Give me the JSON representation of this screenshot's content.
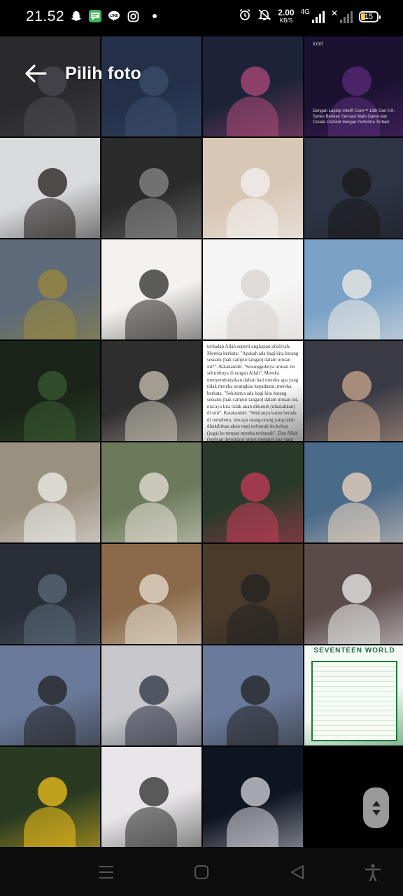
{
  "status_bar": {
    "time": "21.52",
    "net_speed_value": "2.00",
    "net_speed_unit": "KB/S",
    "network_type": "4G",
    "battery_level": "15",
    "notification_icons": [
      "snapchat-icon",
      "messages-icon",
      "line-icon",
      "instagram-icon"
    ],
    "status_icons": [
      "alarm-icon",
      "mute-icon"
    ]
  },
  "header": {
    "title": "Pilih foto",
    "back_icon": "arrow-left-icon"
  },
  "photos": [
    {
      "bg": "#2a2a2e",
      "accent": "#4a4a50"
    },
    {
      "bg": "#24304a",
      "accent": "#3a4d6b"
    },
    {
      "bg": "#1c2338",
      "accent": "#b04a7a"
    },
    {
      "bg": "#1a1230",
      "accent": "#5a2b7a",
      "ad_logo": "intel",
      "ad_text": "Dengan Laptop Intel® Core™ 13th Gen HX-Series Berikan Sensasi Main Game dan Create Content dengan Performa Terbaik"
    },
    {
      "bg": "#d9dadc",
      "accent": "#1e1a18"
    },
    {
      "bg": "#2b2b2b",
      "accent": "#8a8a8a"
    },
    {
      "bg": "#d9c7b5",
      "accent": "#f2f2f2"
    },
    {
      "bg": "#2d3446",
      "accent": "#1a1a1a"
    },
    {
      "bg": "#5c6a7a",
      "accent": "#9b8a3a"
    },
    {
      "bg": "#f4f1ee",
      "accent": "#2a2a2a"
    },
    {
      "bg": "#f5f5f5",
      "accent": "#d8d2cc"
    },
    {
      "bg": "#7aa1c6",
      "accent": "#f0ede6"
    },
    {
      "bg": "#1a2418",
      "accent": "#3a5a32"
    },
    {
      "bg": "#2e2e2e",
      "accent": "#c9c2b4"
    },
    {
      "bg": "#ffffff",
      "accent": "#333333",
      "doc_text": "terhadap Allah seperti ungkapan pikiliyah. Mereka berkata: \"Apakah ada bagi kita barang sesuatu (hak campur tangan) dalam urusan ini?\". Katakanlah: \"Sesungguhnya urusan itu seluruhnya di tangan Allah\". Mereka menyembunyikan dalam hati mereka apa yang tidak mereka terangkan kepadamu; mereka berkata: \"Sekiranya ada bagi kita barang sesuatu (hak campur tangan) dalam urusan ini, niscaya kita tidak akan dibunuh (dikalahkan) di sini\". Katakanlah: \"Sekiranya kamu berada di rumahmu, niscaya orang-orang yang telah ditakdirkan akan mati terbunuh itu keluar (juga) ke tempat mereka terbunuh\". Dan Allah (berbuat demikian) untuk menguji apa yang ada dalam dadamu dan untuk membersihkan apa yang ada dalam hatimu. Allah Maha Mengetahui isi hati."
    },
    {
      "bg": "#3a3a44",
      "accent": "#c9a88e"
    },
    {
      "bg": "#9a9080",
      "accent": "#f0f0ec"
    },
    {
      "bg": "#6b7a5a",
      "accent": "#e8e2d8"
    },
    {
      "bg": "#2a3a2a",
      "accent": "#c83a5a"
    },
    {
      "bg": "#4a6a8a",
      "accent": "#f0d8c0"
    },
    {
      "bg": "#2a2e36",
      "accent": "#5a6a7a"
    },
    {
      "bg": "#8a6a4a",
      "accent": "#e8e0d2"
    },
    {
      "bg": "#4a3a2a",
      "accent": "#222222"
    },
    {
      "bg": "#5a4a4a",
      "accent": "#f0f0f0"
    },
    {
      "bg": "#6a7a9a",
      "accent": "#222222"
    },
    {
      "bg": "#c8c8cc",
      "accent": "#2a3040"
    },
    {
      "bg": "#6a7a9a",
      "accent": "#222222"
    },
    {
      "bg": "#f4f9f4",
      "accent": "#1f7a3a",
      "schedule_title": "SEVENTEEN WORLD"
    },
    {
      "bg": "#2a3a22",
      "accent": "#f2c21a"
    },
    {
      "bg": "#e8e6e8",
      "accent": "#2a2a2a"
    },
    {
      "bg": "#0e1420",
      "accent": "#d8d8e0"
    }
  ],
  "scroll_handle": {
    "up_icon": "triangle-up-icon",
    "down_icon": "triangle-down-icon"
  },
  "nav_bar": {
    "icons": [
      "menu-icon",
      "home-icon",
      "back-triangle-icon",
      "accessibility-icon"
    ]
  }
}
